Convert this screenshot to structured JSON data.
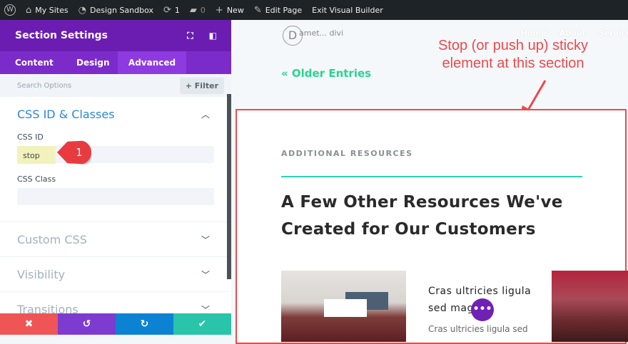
{
  "adminbar": {
    "wp": "W",
    "my_sites": "My Sites",
    "site": "Design Sandbox",
    "updates": "1",
    "comments": "0",
    "new": "New",
    "edit": "Edit Page",
    "exit": "Exit Visual Builder"
  },
  "panel": {
    "title": "Section Settings",
    "tabs": [
      "Content",
      "Design",
      "Advanced"
    ],
    "search_placeholder": "Search Options",
    "filter": "+ Filter",
    "css_section": "CSS ID & Classes",
    "css_id_label": "CSS ID",
    "css_id_value": "stop",
    "css_class_label": "CSS Class",
    "css_class_value": "",
    "sections": [
      "Custom CSS",
      "Visibility",
      "Transitions"
    ]
  },
  "annotation": {
    "badge": "1",
    "note": "Stop (or push up) sticky element at this section"
  },
  "site": {
    "logo": "D",
    "logo_text": "amet... divi",
    "nav": [
      "Home",
      "About",
      "Services"
    ],
    "older": "« Older Entries",
    "kicker": "ADDITIONAL RESOURCES",
    "heading": "A Few Other Resources We've Created for Our Customers",
    "card_title": "Cras ultricies ligula sed magna",
    "card_text": "Cras ultricies ligula sed",
    "dots": "•••"
  },
  "colors": {
    "accent": "#6b1db1",
    "teal": "#2ad48f",
    "annotation": "#f1484a"
  }
}
